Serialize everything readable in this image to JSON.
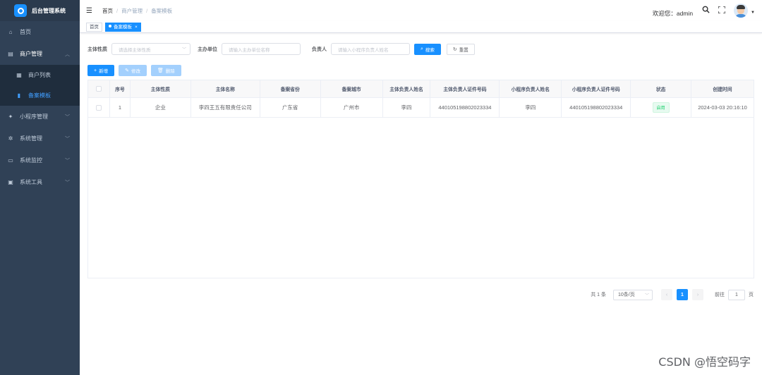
{
  "app": {
    "title": "后台管理系统"
  },
  "sidebar": {
    "items": [
      {
        "label": "首页",
        "icon": "home-icon",
        "glyph": "⌂"
      },
      {
        "label": "商户管理",
        "icon": "store-icon",
        "glyph": "▤",
        "open": true,
        "children": [
          {
            "label": "商户列表",
            "icon": "list-icon",
            "glyph": "▦"
          },
          {
            "label": "备案模板",
            "icon": "template-icon",
            "glyph": "▮",
            "active": true
          }
        ]
      },
      {
        "label": "小程序管理",
        "icon": "miniprogram-icon",
        "glyph": "✦"
      },
      {
        "label": "系统管理",
        "icon": "gear-icon",
        "glyph": "✲"
      },
      {
        "label": "系统监控",
        "icon": "monitor-icon",
        "glyph": "▭"
      },
      {
        "label": "系统工具",
        "icon": "toolbox-icon",
        "glyph": "▣"
      }
    ]
  },
  "header": {
    "breadcrumb": [
      "首页",
      "商户管理",
      "备案模板"
    ],
    "welcome": "欢迎您：admin"
  },
  "tags": [
    {
      "label": "首页",
      "active": false
    },
    {
      "label": "备案模板",
      "active": true
    }
  ],
  "search": {
    "field1": {
      "label": "主体性质",
      "placeholder": "请选择主体性质"
    },
    "field2": {
      "label": "主办单位",
      "placeholder": "请输入主办单位名称"
    },
    "field3": {
      "label": "负责人",
      "placeholder": "请输入小程序负责人姓名"
    },
    "search_btn": "搜索",
    "reset_btn": "重置"
  },
  "actions": {
    "add": "新增",
    "edit": "修改",
    "delete": "删除"
  },
  "table": {
    "columns": [
      "序号",
      "主体性质",
      "主体名称",
      "备案省份",
      "备案城市",
      "主体负责人姓名",
      "主体负责人证件号码",
      "小程序负责人姓名",
      "小程序负责人证件号码",
      "状态",
      "创建时间"
    ],
    "rows": [
      [
        "1",
        "企业",
        "李四王五有限责任公司",
        "广东省",
        "广州市",
        "李四",
        "440105198802023334",
        "李四",
        "440105198802023334",
        "启用",
        "2024-03-03 20:16:10"
      ]
    ]
  },
  "pagination": {
    "total": "共 1 条",
    "page_size": "10条/页",
    "current": "1",
    "goto_label": "前往",
    "goto_value": "1",
    "page_unit": "页"
  },
  "watermark": "CSDN @悟空码字",
  "colors": {
    "primary": "#1890ff",
    "sidebar": "#304156",
    "success": "#13ce66"
  }
}
